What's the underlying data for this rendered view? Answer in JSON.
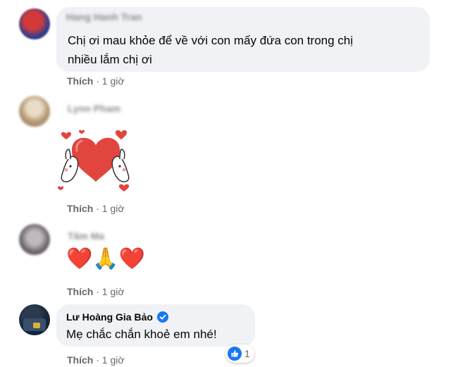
{
  "comments": [
    {
      "author": "Hang Hanh Tran",
      "text_line1": "Chị ơi mau khỏe để về với con mấy đứa con trong chị",
      "text_line2": "nhiều lắm chị ơi",
      "like_label": "Thích",
      "time": "1 giờ"
    },
    {
      "author": "Lynn Pham",
      "sticker_icon": "heart-bunnies-sticker",
      "like_label": "Thích",
      "time": "1 giờ"
    },
    {
      "author": "Tâm Ma",
      "emojis": "❤️🙏❤️",
      "like_label": "Thích",
      "time": "1 giờ"
    },
    {
      "author": "Lư Hoàng Gia Bảo",
      "verified": true,
      "text": "Mẹ chắc chắn khoẻ em nhé!",
      "like_label": "Thích",
      "time": "1 giờ",
      "reaction_count": "1",
      "reaction_icon": "thumbs-up-icon"
    }
  ],
  "separator": "·",
  "colors": {
    "bubble": "#f0f2f5",
    "meta": "#65676b",
    "reaction_blue": "#1877f2"
  }
}
